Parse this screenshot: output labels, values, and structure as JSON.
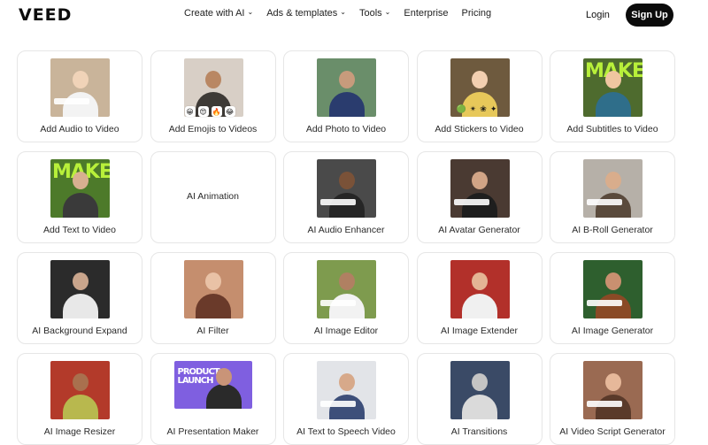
{
  "header": {
    "logo": "VEED",
    "nav": [
      {
        "label": "Create with AI",
        "has_dropdown": true
      },
      {
        "label": "Ads & templates",
        "has_dropdown": true
      },
      {
        "label": "Tools",
        "has_dropdown": true
      },
      {
        "label": "Enterprise",
        "has_dropdown": false
      },
      {
        "label": "Pricing",
        "has_dropdown": false
      }
    ],
    "login": "Login",
    "signup": "Sign Up"
  },
  "cards": [
    {
      "label": "Add Audio to Video",
      "bg": "#c9b49a",
      "skin": "#f0d3b8",
      "cloth": "#f3f3f3"
    },
    {
      "label": "Add Emojis to Videos",
      "bg": "#d8cfc6",
      "skin": "#b98763",
      "cloth": "#3e3a36"
    },
    {
      "label": "Add Photo to Video",
      "bg": "#6a8e6a",
      "skin": "#c79b7c",
      "cloth": "#2a3c6e"
    },
    {
      "label": "Add Stickers to Video",
      "bg": "#6e5a3e",
      "skin": "#f2cfb0",
      "cloth": "#e7c85a"
    },
    {
      "label": "Add Subtitles to Video",
      "bg": "#4e6b2e",
      "skin": "#f0c6a0",
      "cloth": "#2f6e8a",
      "bigtext": "MAKE"
    },
    {
      "label": "Add Text to Video",
      "bg": "#4d7a2a",
      "skin": "#d8b090",
      "cloth": "#3a3a3a",
      "bigtext": "MAKE"
    },
    {
      "label": "AI Animation",
      "text_only": true
    },
    {
      "label": "AI Audio Enhancer",
      "bg": "#4a4a4a",
      "skin": "#7a5238",
      "cloth": "#262626"
    },
    {
      "label": "AI Avatar Generator",
      "bg": "#4a3a32",
      "skin": "#d1a486",
      "cloth": "#1e1e1e"
    },
    {
      "label": "AI B-Roll Generator",
      "bg": "#b6b0a8",
      "skin": "#d9ad8c",
      "cloth": "#5a4a3c"
    },
    {
      "label": "AI Background Expand",
      "bg": "#2b2b2b",
      "skin": "#c9a58c",
      "cloth": "#e8e8e8"
    },
    {
      "label": "AI Filter",
      "bg": "#c58e6e",
      "skin": "#e9c2a6",
      "cloth": "#6a3a2a"
    },
    {
      "label": "AI Image Editor",
      "bg": "#7e9b4e",
      "skin": "#b08062",
      "cloth": "#f2f2f2"
    },
    {
      "label": "AI Image Extender",
      "bg": "#b2302a",
      "skin": "#e4b494",
      "cloth": "#f0f0f0"
    },
    {
      "label": "AI Image Generator",
      "bg": "#2e5f2e",
      "skin": "#c99070",
      "cloth": "#8a4a26"
    },
    {
      "label": "AI Image Resizer",
      "bg": "#b33a2a",
      "skin": "#a9704e",
      "cloth": "#b8b84e"
    },
    {
      "label": "AI Presentation Maker",
      "bg": "#7f5fe0",
      "skin": "#c99478",
      "cloth": "#2a2a2a",
      "bigtext": "PRODUCT LAUNCH",
      "wide": true
    },
    {
      "label": "AI Text to Speech Video",
      "bg": "#e2e4e8",
      "skin": "#d7a98a",
      "cloth": "#3d4f7a"
    },
    {
      "label": "AI Transitions",
      "bg": "#3a4a66",
      "skin": "#c4c4c4",
      "cloth": "#dadada"
    },
    {
      "label": "AI Video Script Generator",
      "bg": "#9a6a52",
      "skin": "#e6b89a",
      "cloth": "#5a3a2a"
    }
  ],
  "icons": {
    "chevron": "chevron-down-icon"
  },
  "emoji_row": [
    "😀",
    "😍",
    "🔥",
    "😂"
  ],
  "sticker_row": [
    "🟢",
    "✴",
    "❀",
    "✦"
  ]
}
